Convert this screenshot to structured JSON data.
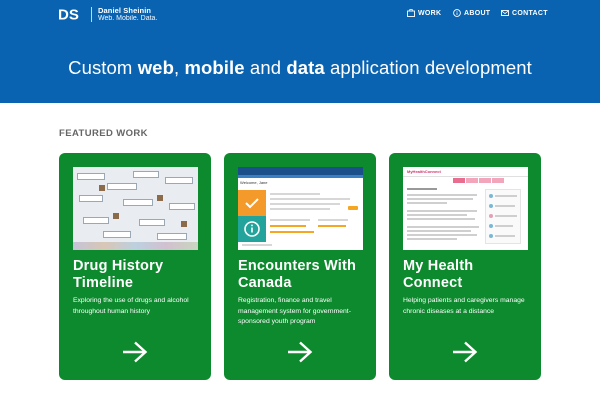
{
  "brand": {
    "logo_text": "DS",
    "name": "Daniel Sheinin",
    "tagline": "Web. Mobile. Data."
  },
  "nav": {
    "items": [
      {
        "label": "WORK",
        "icon": "briefcase-icon"
      },
      {
        "label": "ABOUT",
        "icon": "info-icon"
      },
      {
        "label": "CONTACT",
        "icon": "envelope-icon"
      }
    ]
  },
  "hero": {
    "parts": [
      "Custom ",
      "web",
      ", ",
      "mobile",
      " and ",
      "data",
      " application development"
    ]
  },
  "featured": {
    "heading": "FEATURED WORK",
    "cards": [
      {
        "title": "Drug History Timeline",
        "description": "Exploring the use of drugs and alcohol throughout human history"
      },
      {
        "title": "Encounters With Canada",
        "description": "Registration, finance and travel management system for government-sponsored youth program",
        "screenshot_text": "Welcome, Jane"
      },
      {
        "title": "My Health Connect",
        "description": "Helping patients and caregivers manage chronic diseases at a distance",
        "screenshot_text": "MyHealthConnect"
      }
    ]
  },
  "colors": {
    "header_blue": "#0a63b1",
    "card_green": "#0e8a2e",
    "heading_gray": "#666666"
  }
}
